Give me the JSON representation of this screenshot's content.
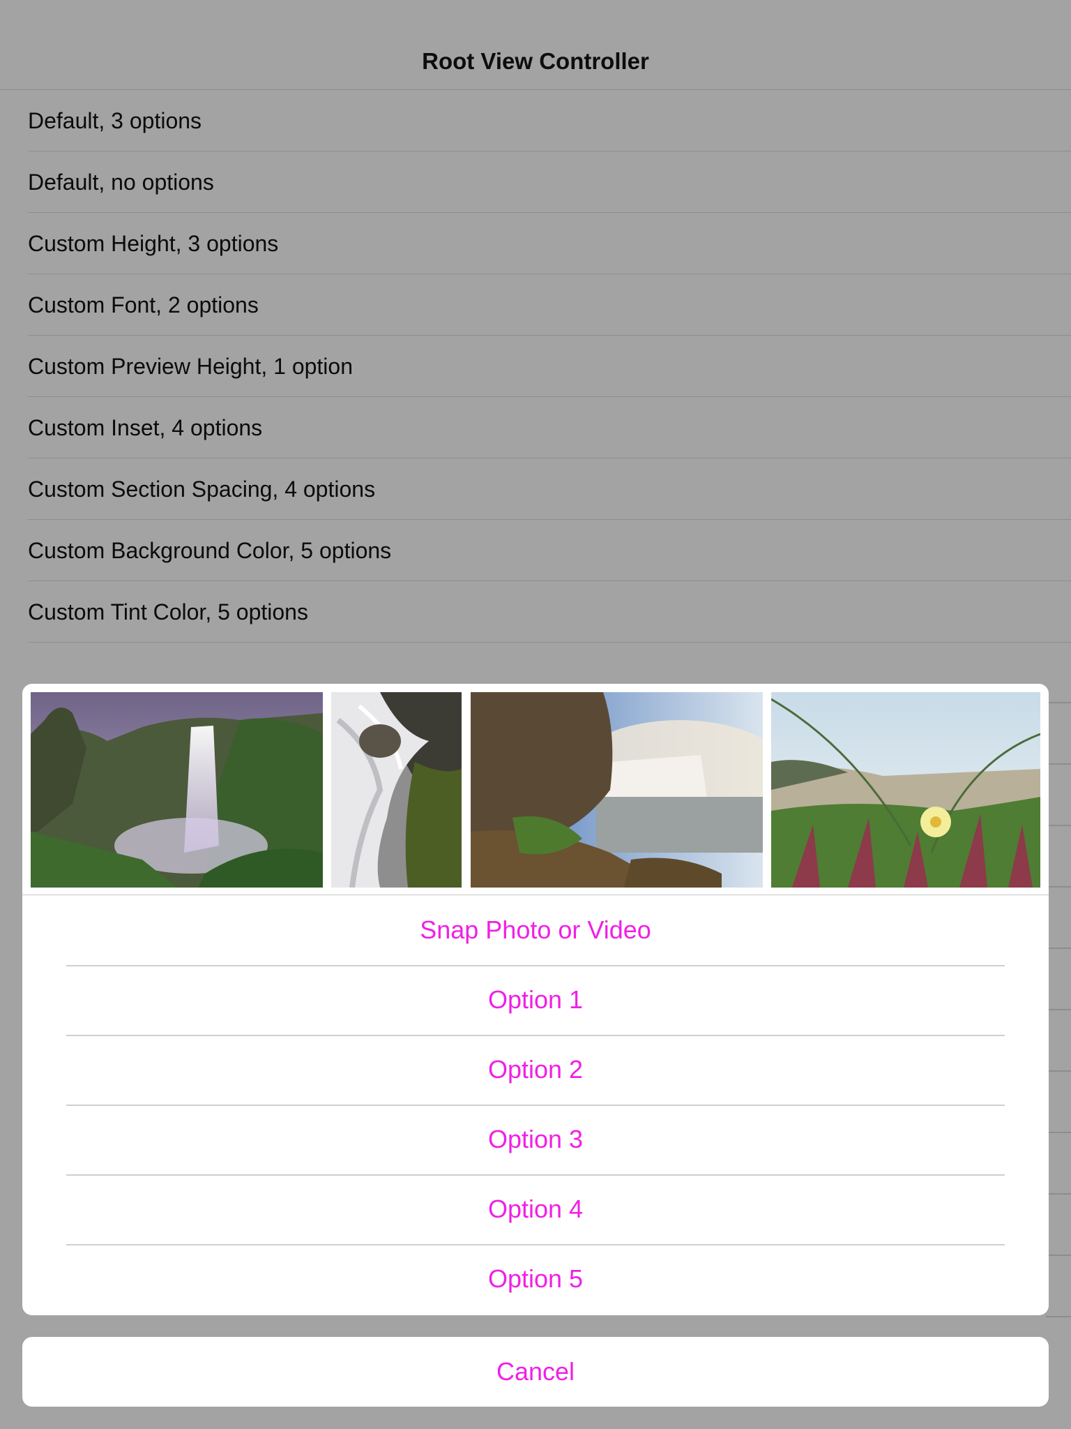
{
  "navbar": {
    "title": "Root View Controller"
  },
  "list": {
    "items": [
      "Default, 3 options",
      "Default, no options",
      "Custom Height, 3 options",
      "Custom Font, 2 options",
      "Custom Preview Height, 1 option",
      "Custom Inset, 4 options",
      "Custom Section Spacing, 4 options",
      "Custom Background Color, 5 options",
      "Custom Tint Color, 5 options"
    ]
  },
  "action_sheet": {
    "preview_images": [
      "waterfall-cliff-photo",
      "cascade-rocks-photo",
      "misty-waterfall-photo",
      "beach-flower-photo"
    ],
    "options": [
      "Snap Photo or Video",
      "Option 1",
      "Option 2",
      "Option 3",
      "Option 4",
      "Option 5"
    ],
    "cancel_label": "Cancel",
    "tint_color": "#f01fe6"
  },
  "colors": {
    "background_dim": "#a3a3a3",
    "sheet_background": "#ffffff"
  }
}
